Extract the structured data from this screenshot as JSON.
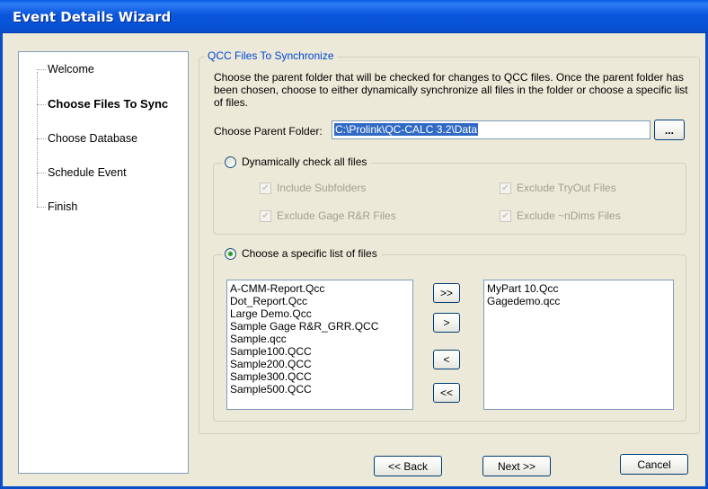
{
  "window": {
    "title": "Event Details Wizard"
  },
  "nav": {
    "items": [
      {
        "label": "Welcome",
        "active": false
      },
      {
        "label": "Choose Files To Sync",
        "active": true
      },
      {
        "label": "Choose Database",
        "active": false
      },
      {
        "label": "Schedule Event",
        "active": false
      },
      {
        "label": "Finish",
        "active": false
      }
    ]
  },
  "main": {
    "group_title": "QCC Files To Synchronize",
    "description": "Choose the parent folder that will be checked for changes to QCC files. Once the parent folder has been chosen, choose to either dynamically synchronize all files in the folder or choose a specific list of files.",
    "folder_label": "Choose Parent Folder:",
    "folder_value": "C:\\Prolink\\QC-CALC 3.2\\Data",
    "browse_label": "...",
    "dynamic": {
      "label": "Dynamically check all files",
      "selected": false,
      "options": [
        {
          "label": "Include Subfolders",
          "checked": true,
          "enabled": false
        },
        {
          "label": "Exclude TryOut Files",
          "checked": true,
          "enabled": false
        },
        {
          "label": "Exclude Gage R&R Files",
          "checked": true,
          "enabled": false
        },
        {
          "label": "Exclude ~nDims Files",
          "checked": true,
          "enabled": false
        }
      ]
    },
    "specific": {
      "label": "Choose a specific list of files",
      "selected": true,
      "available_files": [
        "A-CMM-Report.Qcc",
        "Dot_Report.Qcc",
        "Large Demo.Qcc",
        "Sample Gage R&R_GRR.QCC",
        "Sample.qcc",
        "Sample100.QCC",
        "Sample200.QCC",
        "Sample300.QCC",
        "Sample500.QCC"
      ],
      "selected_files": [
        "MyPart 10.Qcc",
        "Gagedemo.qcc"
      ],
      "move_all_right": ">>",
      "move_right": ">",
      "move_left": "<",
      "move_all_left": "<<"
    }
  },
  "footer": {
    "back_label": "<< Back",
    "next_label": "Next >>",
    "cancel_label": "Cancel"
  },
  "colors": {
    "title_bar": "#0a56dc",
    "group_title": "#0046d5",
    "selection": "#316ac5",
    "radio_dot": "#21a121"
  }
}
